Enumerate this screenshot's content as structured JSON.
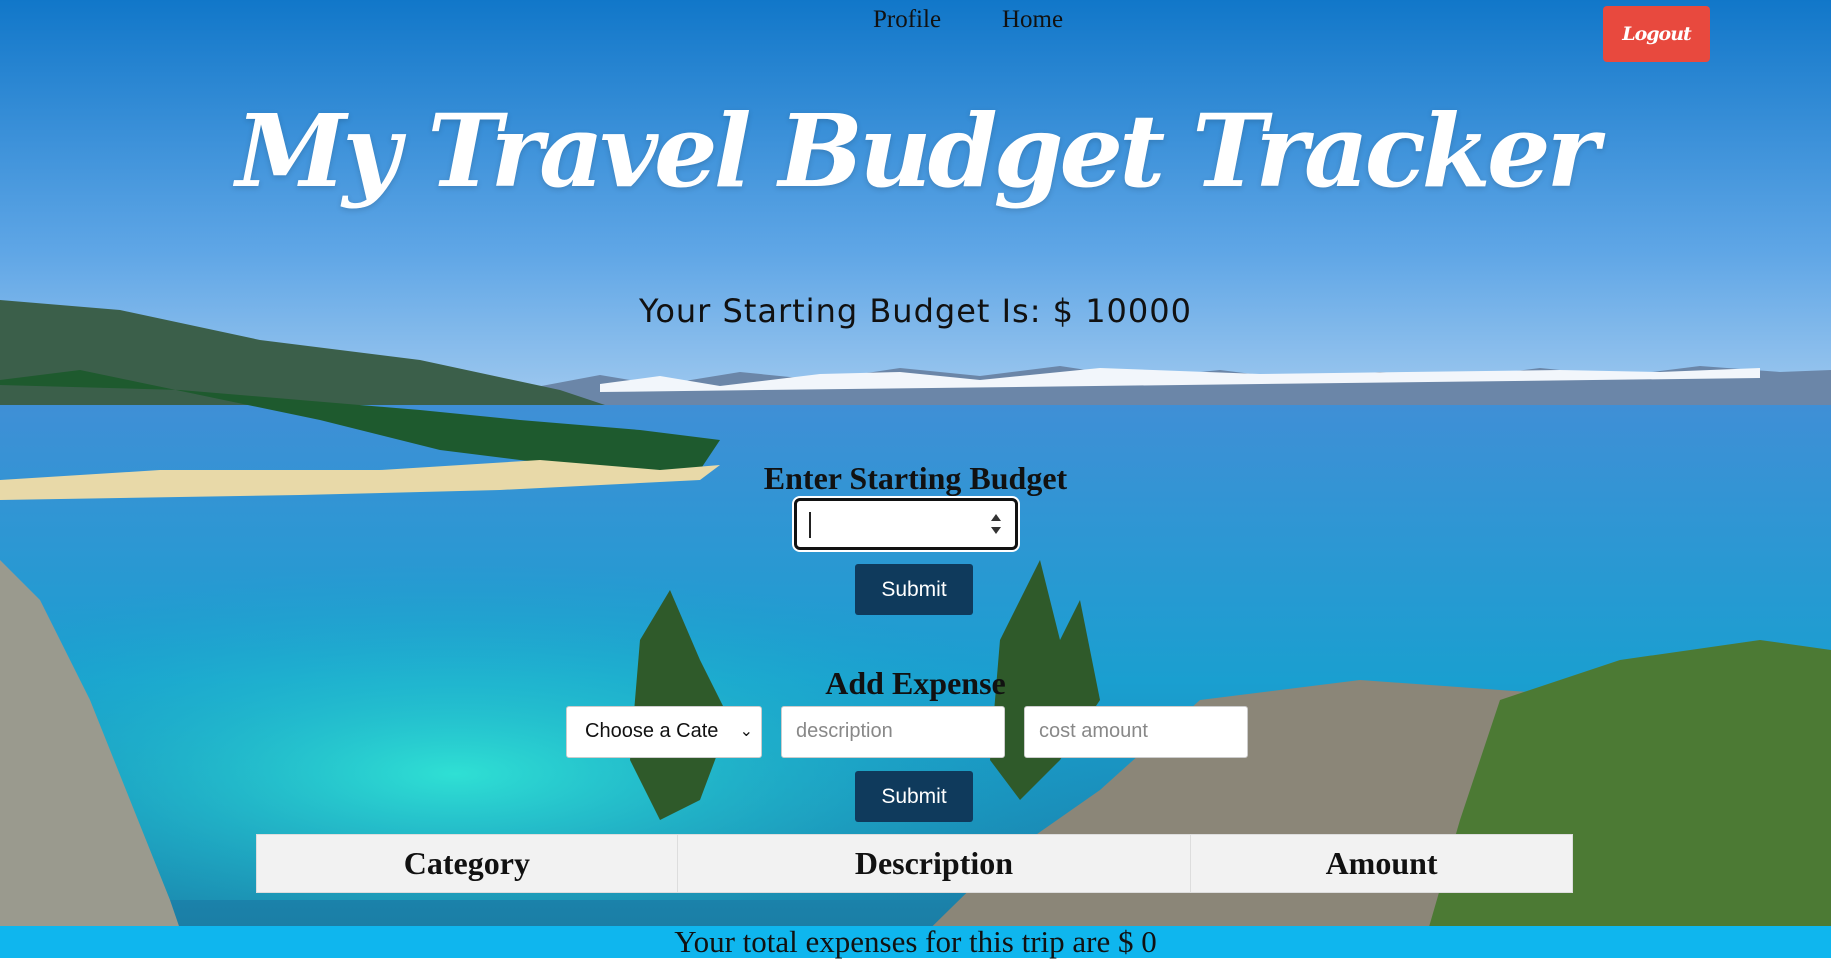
{
  "nav": {
    "profile": "Profile",
    "home": "Home",
    "logout": "Logout"
  },
  "title": "My Travel Budget Tracker",
  "budget_display": "Your Starting Budget Is: $ 10000",
  "starting_budget": {
    "heading": "Enter Starting Budget",
    "input_value": "",
    "submit": "Submit"
  },
  "expense": {
    "heading": "Add Expense",
    "category_selected": "Choose a Cate",
    "description_placeholder": "description",
    "cost_placeholder": "cost amount",
    "submit": "Submit"
  },
  "table": {
    "headers": [
      "Category",
      "Description",
      "Amount"
    ]
  },
  "footer": "Your total expenses for this trip are $ 0",
  "colors": {
    "logout": "#e8493e",
    "button": "#0f3a5c",
    "footer": "#0fb6ee",
    "table_header": "#f2f2f2"
  }
}
